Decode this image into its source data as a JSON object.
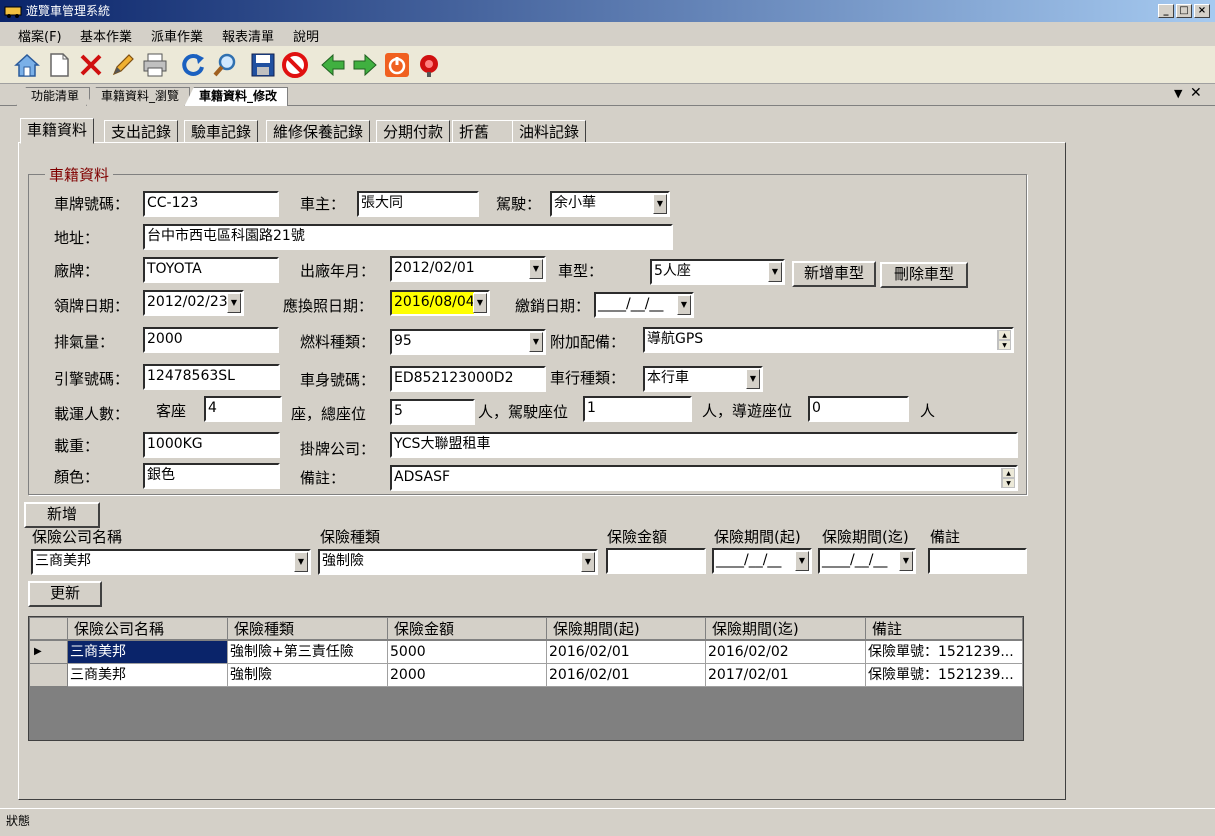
{
  "window": {
    "title": "遊覽車管理系統"
  },
  "menu": [
    "檔案(F)",
    "基本作業",
    "派車作業",
    "報表清單",
    "說明"
  ],
  "doc_tabs": [
    "功能清單",
    "車籍資料_瀏覽",
    "車籍資料_修改"
  ],
  "inner_tabs": [
    "車籍資料",
    "支出記錄",
    "驗車記錄",
    "維修保養記錄",
    "分期付款",
    "折舊",
    "油料記錄"
  ],
  "form": {
    "legend": "車籍資料",
    "labels": {
      "plate": "車牌號碼：",
      "owner": "車主：",
      "driver": "駕駛：",
      "address": "地址：",
      "brand": "廠牌：",
      "mfg_date": "出廠年月：",
      "car_type": "車型：",
      "license_date": "領牌日期：",
      "renew_date": "應換照日期：",
      "cancel_date": "繳銷日期：",
      "displacement": "排氣量：",
      "fuel": "燃料種類：",
      "equipment": "附加配備：",
      "engine": "引擎號碼：",
      "body": "車身號碼：",
      "company_type": "車行種類：",
      "capacity": "載運人數：",
      "guest_seat": "客座",
      "total_seat": "座，總座位",
      "driver_seat": "人，駕駛座位",
      "guide_seat": "人，導遊座位",
      "person": "人",
      "load": "載重：",
      "plate_company": "掛牌公司：",
      "color": "顏色：",
      "memo": "備註："
    },
    "values": {
      "plate": "CC-123",
      "owner": "張大同",
      "driver": "余小華",
      "address": "台中市西屯區科園路21號",
      "brand": "TOYOTA",
      "mfg_date": "2012/02/01",
      "car_type": "5人座",
      "license_date": "2012/02/23",
      "renew_date": "2016/08/04",
      "cancel_date": "____/__/__",
      "displacement": "2000",
      "fuel": "95",
      "equipment": "導航GPS",
      "engine": "12478563SL",
      "body": "ED852123000D2",
      "company_type": "本行車",
      "guest_seat": "4",
      "total_seat": "5",
      "driver_seat": "1",
      "guide_seat": "0",
      "load": "1000KG",
      "plate_company": "YCS大聯盟租車",
      "color": "銀色",
      "memo": "ADSASF"
    },
    "buttons": {
      "add_type": "新增車型",
      "del_type": "刪除車型"
    }
  },
  "insurance": {
    "add_button": "新增",
    "update_button": "更新",
    "labels": {
      "company": "保險公司名稱",
      "type": "保險種類",
      "amount": "保險金額",
      "start": "保險期間(起)",
      "end": "保險期間(迄)",
      "memo": "備註"
    },
    "values": {
      "company": "三商美邦",
      "type": "強制險",
      "amount": "",
      "start": "____/__/__",
      "end": "____/__/__",
      "memo": ""
    }
  },
  "table": {
    "columns": [
      "保險公司名稱",
      "保險種類",
      "保險金額",
      "保險期間(起)",
      "保險期間(迄)",
      "備註"
    ],
    "rows": [
      [
        "三商美邦",
        "強制險+第三責任險",
        "5000",
        "2016/02/01",
        "2016/02/02",
        "保險單號：1521239..."
      ],
      [
        "三商美邦",
        "強制險",
        "2000",
        "2016/02/01",
        "2017/02/01",
        "保險單號：1521239..."
      ]
    ]
  },
  "status": "狀態"
}
